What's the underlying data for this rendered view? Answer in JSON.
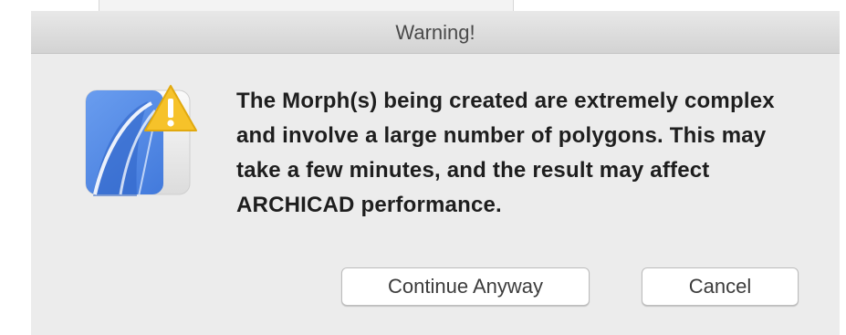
{
  "dialog": {
    "title": "Warning!",
    "message": "The Morph(s) being created are extremely complex and involve a large number of polygons. This may take a few minutes, and the result may affect ARCHICAD performance.",
    "icon": "archicad-app-icon",
    "badge_icon": "warning-triangle-icon"
  },
  "buttons": {
    "continue_label": "Continue Anyway",
    "cancel_label": "Cancel"
  },
  "colors": {
    "accent_blue": "#3b78e0",
    "warning_yellow": "#f7c325"
  }
}
